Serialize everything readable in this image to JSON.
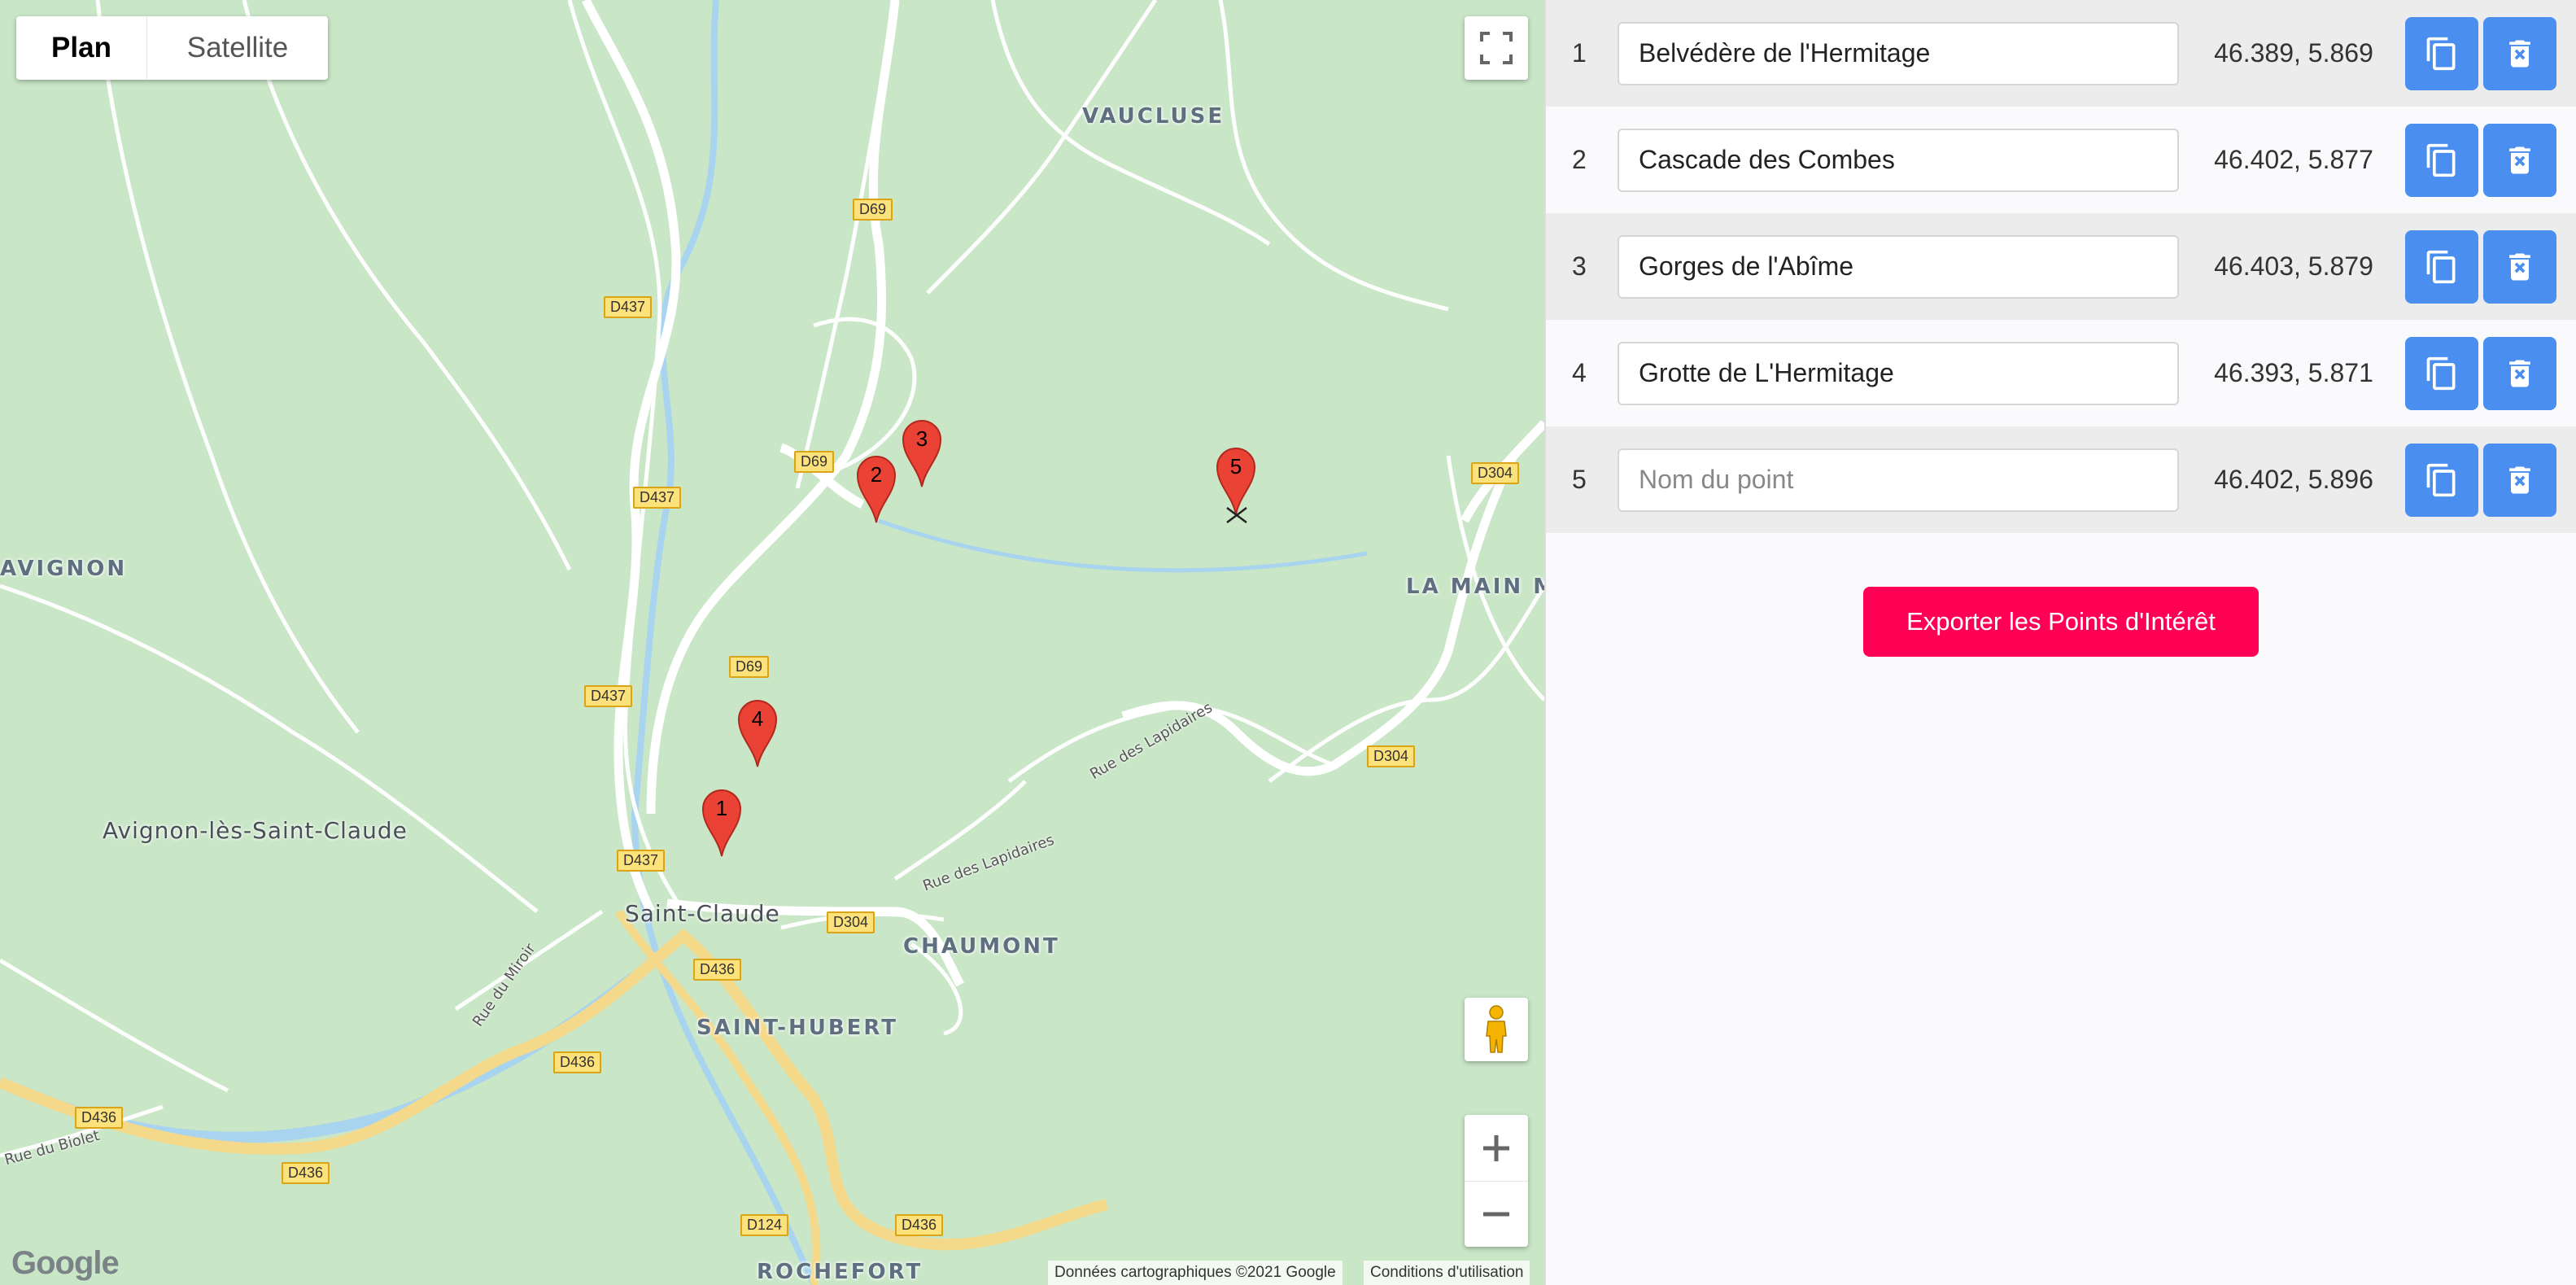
{
  "map": {
    "type_plan": "Plan",
    "type_satellite": "Satellite",
    "labels": {
      "vaucluse": "VAUCLUSE",
      "avignon": "AVIGNON",
      "la_main": "LA MAIN MO",
      "avignon_les": "Avignon-lès-Saint-Claude",
      "saint_claude": "Saint-Claude",
      "chaumont": "CHAUMONT",
      "saint_hubert": "SAINT-HUBERT",
      "rochefort": "ROCHEFORT",
      "rue_lapidaires_1": "Rue des Lapidaires",
      "rue_lapidaires_2": "Rue des Lapidaires",
      "rue_miroir": "Rue du Miroir",
      "rue_biolet": "Rue du Biolet"
    },
    "road_shields": {
      "d69_a": "D69",
      "d437_a": "D437",
      "d69_b": "D69",
      "d437_b": "D437",
      "d304_a": "D304",
      "d69_c": "D69",
      "d437_c": "D437",
      "d304_b": "D304",
      "d437_d": "D437",
      "d304_c": "D304",
      "d436_a": "D436",
      "d436_b": "D436",
      "d436_c": "D436",
      "d436_d": "D436",
      "d124": "D124",
      "d436_e": "D436"
    },
    "markers": [
      "1",
      "2",
      "3",
      "4",
      "5"
    ],
    "attribution": "Données cartographiques ©2021 Google",
    "terms": "Conditions d'utilisation",
    "logo": "Google"
  },
  "points": [
    {
      "index": "1",
      "name": "Belvédère de l'Hermitage",
      "coords": "46.389, 5.869"
    },
    {
      "index": "2",
      "name": "Cascade des Combes",
      "coords": "46.402, 5.877"
    },
    {
      "index": "3",
      "name": "Gorges de l'Abîme",
      "coords": "46.403, 5.879"
    },
    {
      "index": "4",
      "name": "Grotte de L'Hermitage",
      "coords": "46.393, 5.871"
    },
    {
      "index": "5",
      "name": "",
      "placeholder": "Nom du point",
      "coords": "46.402, 5.896"
    }
  ],
  "export_label": "Exporter les Points d'Intérêt",
  "colors": {
    "accent": "#4a8ef0",
    "export": "#ff0055",
    "marker": "#ea4335",
    "map_bg": "#c9e6c7"
  }
}
